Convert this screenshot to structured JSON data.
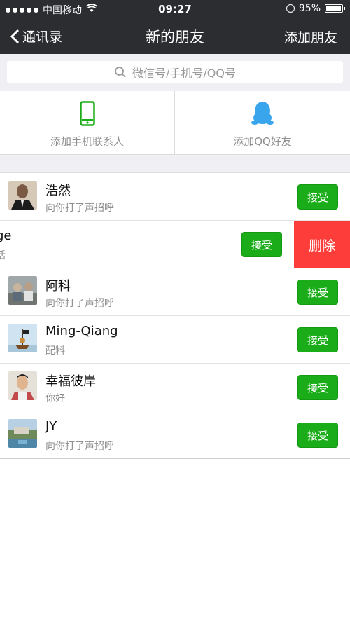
{
  "status": {
    "carrier": "中国移动",
    "time": "09:27",
    "battery": "95%"
  },
  "nav": {
    "back_label": "通讯录",
    "title": "新的朋友",
    "action": "添加朋友"
  },
  "search": {
    "placeholder": "微信号/手机号/QQ号"
  },
  "quick_add": [
    {
      "label": "添加手机联系人",
      "icon": "phone-icon"
    },
    {
      "label": "添加QQ好友",
      "icon": "qq-penguin-icon"
    }
  ],
  "requests": [
    {
      "name": "浩然",
      "message": "向你打了声招呼",
      "action": "接受"
    },
    {
      "name": "ge",
      "message": "话",
      "action": "接受",
      "delete": "删除"
    },
    {
      "name": "阿科",
      "message": "向你打了声招呼",
      "action": "接受"
    },
    {
      "name": "Ming-Qiang",
      "message": "配料",
      "action": "接受"
    },
    {
      "name": "幸福彼岸",
      "message": "你好",
      "action": "接受"
    },
    {
      "name": "JY",
      "message": "向你打了声招呼",
      "action": "接受"
    }
  ],
  "colors": {
    "accent_green": "#1aad19",
    "delete_red": "#fc3d39",
    "nav_bg": "#2c2d31"
  }
}
